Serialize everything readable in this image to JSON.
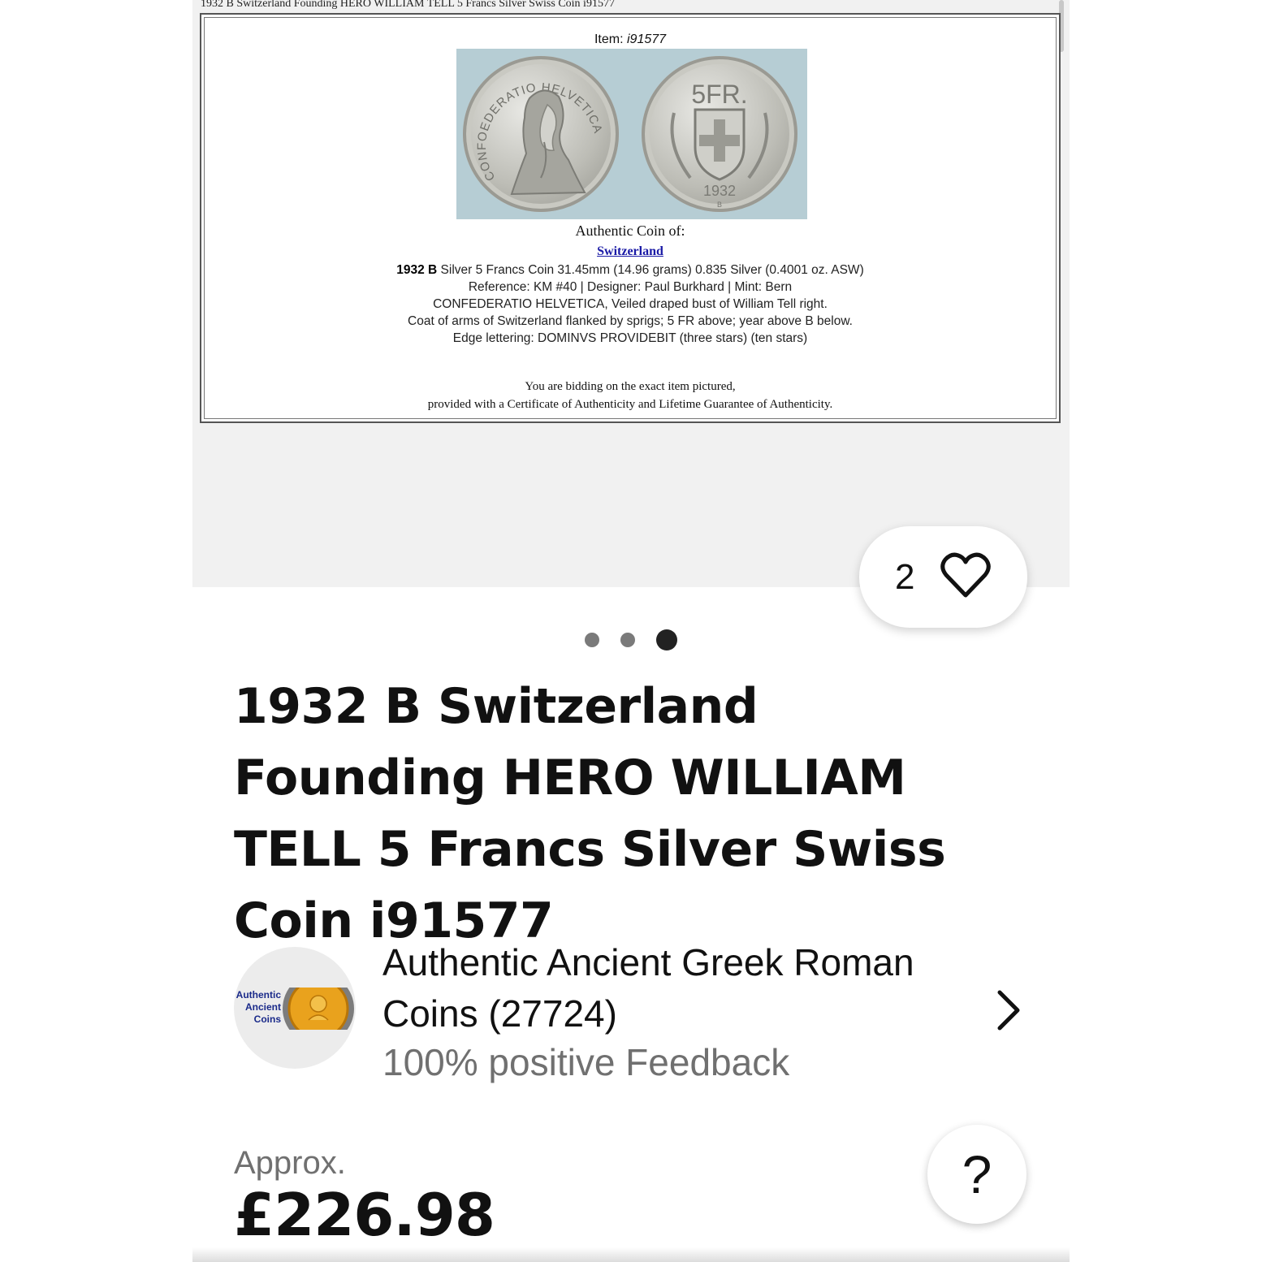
{
  "gallery": {
    "doc_title": "1932 B Switzerland Founding HERO WILLIAM TELL 5 Francs Silver Swiss Coin i91577",
    "item_label": "Item:",
    "item_number": "i91577",
    "obverse_legend": "CONFOEDERATIO HELVETICA",
    "reverse_denomination": "5FR.",
    "reverse_year": "1932",
    "reverse_mintmark": "B",
    "authentic_coin_of": "Authentic Coin of:",
    "country": "Switzerland",
    "desc_line1_bold": "1932 B",
    "desc_line1": " Silver 5 Francs Coin 31.45mm (14.96 grams) 0.835 Silver (0.4001 oz. ASW)",
    "desc_line2": "Reference: KM #40 | Designer: Paul Burkhard | Mint: Bern",
    "desc_line3": "CONFEDERATIO HELVETICA, Veiled draped bust of William Tell right.",
    "desc_line4": "Coat of arms of Switzerland flanked by sprigs; 5 FR above; year above B below.",
    "desc_line5": "Edge lettering: DOMINVS PROVIDEBIT (three stars) (ten stars)",
    "bid_line1": "You are bidding on the exact item pictured,",
    "bid_line2": "provided with a Certificate of Authenticity and Lifetime Guarantee of Authenticity.",
    "image_count": 3,
    "active_image": 3
  },
  "watch": {
    "count": "2",
    "icon": "heart-icon"
  },
  "listing": {
    "title": "1932 B Switzerland Founding HERO WILLIAM TELL 5 Francs Silver Swiss Coin i91577"
  },
  "seller": {
    "avatar_text_1": "Authentic",
    "avatar_text_2": "Ancient",
    "avatar_text_3": "Coins",
    "name": "Authentic Ancient Greek Roman Coins (27724)",
    "feedback": "100% positive Feedback"
  },
  "price": {
    "approx_label": "Approx.",
    "value": "£226.98"
  },
  "help": {
    "label": "?"
  },
  "colors": {
    "link": "#1a1aa6",
    "text": "#111111",
    "muted": "#707070",
    "gallery_bg": "#f1f1f1"
  }
}
